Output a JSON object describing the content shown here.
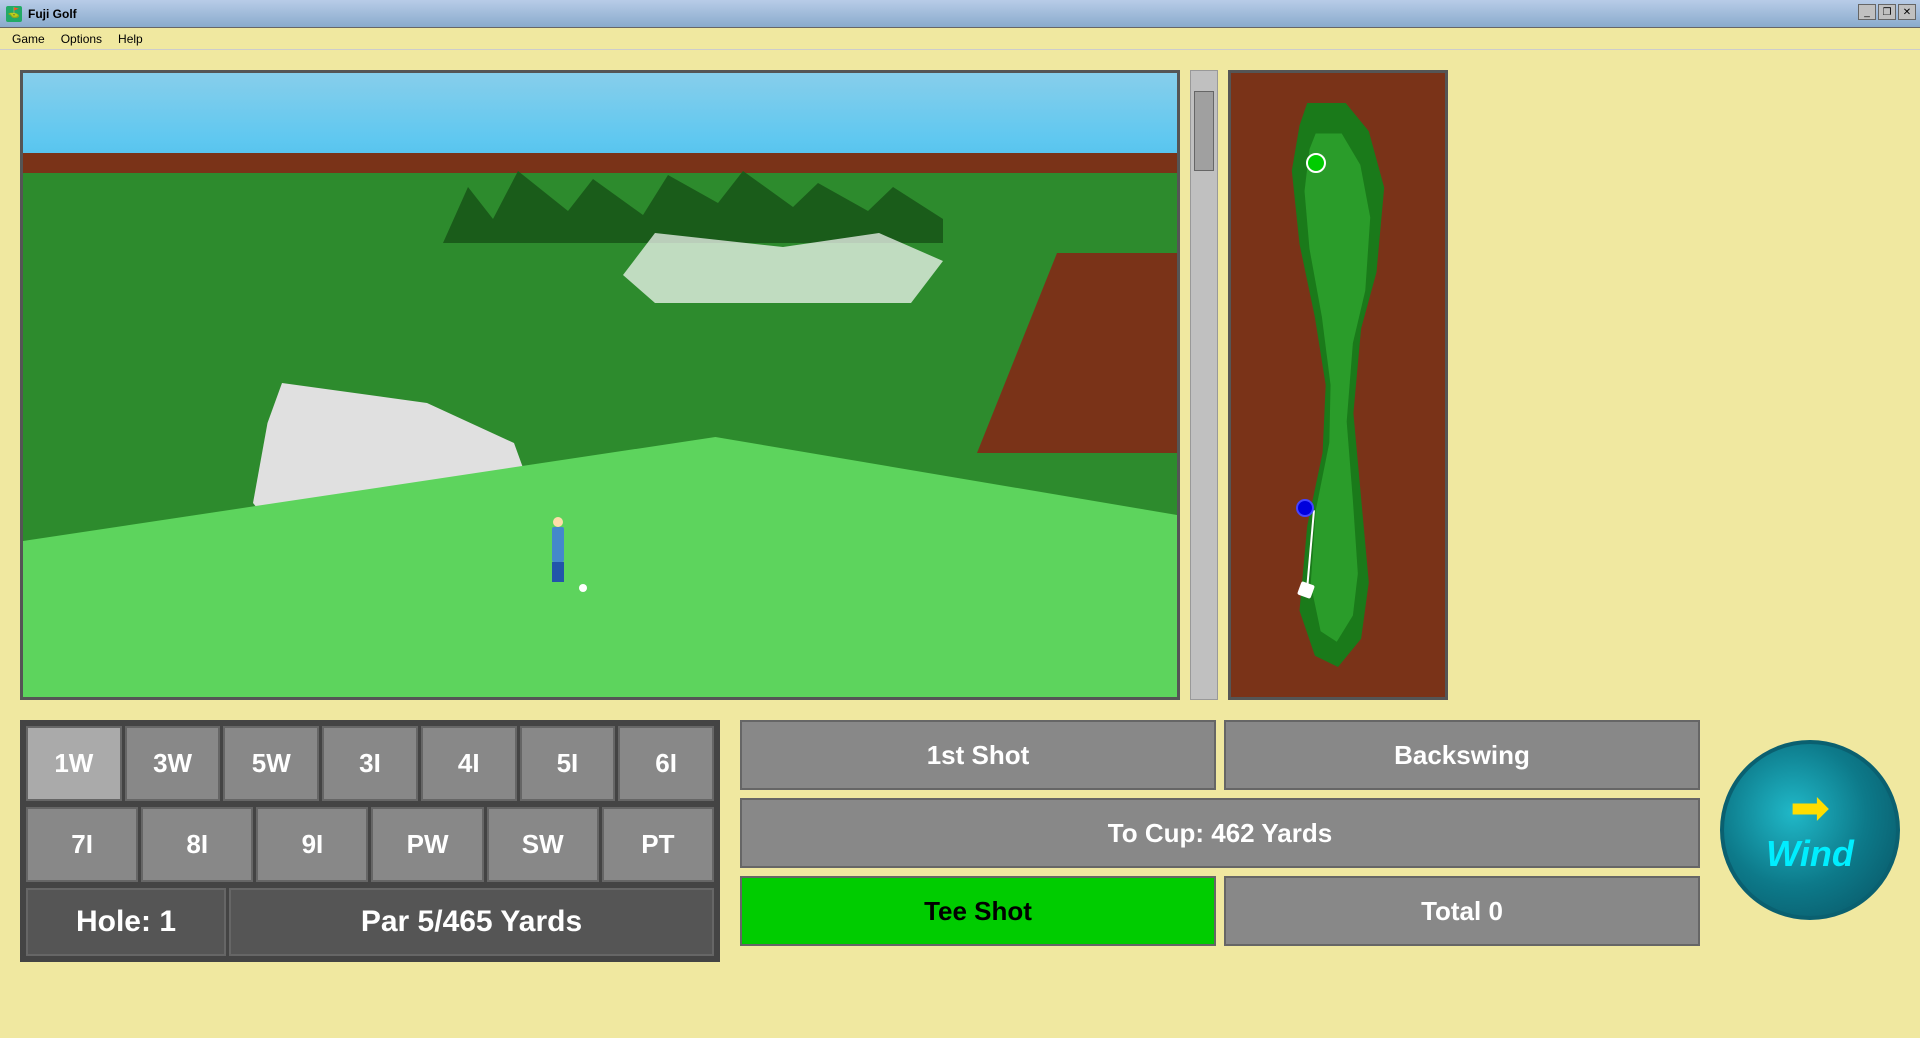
{
  "window": {
    "title": "Fuji Golf",
    "icon": "⛳"
  },
  "menubar": {
    "items": [
      "Game",
      "Options",
      "Help"
    ]
  },
  "clubs": {
    "row1": [
      "1W",
      "3W",
      "5W",
      "3I",
      "4I",
      "5I",
      "6I"
    ],
    "row2": [
      "7I",
      "8I",
      "9I",
      "PW",
      "SW",
      "PT"
    ]
  },
  "info": {
    "hole_label": "Hole: 1",
    "par_label": "Par 5/465 Yards"
  },
  "controls": {
    "shot1_label": "1st Shot",
    "backswing_label": "Backswing",
    "to_cup_label": "To Cup: 462 Yards",
    "tee_shot_label": "Tee Shot",
    "total_label": "Total 0"
  },
  "wind": {
    "label": "Wind"
  },
  "titlebar_buttons": {
    "minimize": "_",
    "restore": "❐",
    "close": "✕"
  }
}
